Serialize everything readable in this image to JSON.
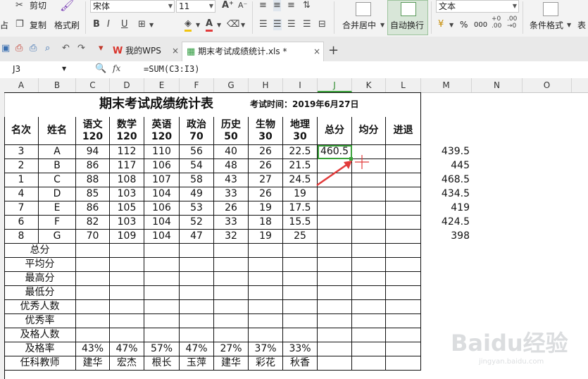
{
  "ribbon": {
    "clipboard": {
      "cut": "剪切",
      "copy": "复制",
      "format_painter": "格式刷",
      "paste_fragment": "占"
    },
    "font": {
      "name": "宋体",
      "size": "11"
    },
    "alignment": {
      "merge_center": "合并居中",
      "wrap_text": "自动换行"
    },
    "number": {
      "format": "文本",
      "percent": "%",
      "thousands": "000"
    },
    "styles": {
      "conditional_format": "条件格式",
      "table_fragment": "表"
    }
  },
  "tabbar": {
    "tabs": [
      {
        "label": "我的WPS",
        "close": "×"
      },
      {
        "label": "期末考试成绩统计.xls *",
        "close": "×"
      }
    ],
    "new_tab": "+"
  },
  "formula_bar": {
    "cell_ref": "J3",
    "fx": "fx",
    "formula": "=SUM(C3:I3)"
  },
  "columns": [
    "A",
    "B",
    "C",
    "D",
    "E",
    "F",
    "G",
    "H",
    "I",
    "J",
    "K",
    "L",
    "M",
    "N",
    "O"
  ],
  "selected_column": "J",
  "sheet": {
    "title": "期末考试成绩统计表",
    "exam_time": "考试时间：2019年6月27日",
    "headers": [
      {
        "l1": "名次"
      },
      {
        "l1": "姓名"
      },
      {
        "l1": "语文",
        "l2": "120"
      },
      {
        "l1": "数学",
        "l2": "120"
      },
      {
        "l1": "英语",
        "l2": "120"
      },
      {
        "l1": "政治",
        "l2": "70"
      },
      {
        "l1": "历史",
        "l2": "50"
      },
      {
        "l1": "生物",
        "l2": "30"
      },
      {
        "l1": "地理",
        "l2": "30"
      },
      {
        "l1": "总分"
      },
      {
        "l1": "均分"
      },
      {
        "l1": "进退"
      }
    ],
    "rows": [
      [
        "3",
        "A",
        "94",
        "112",
        "110",
        "56",
        "40",
        "26",
        "22.5",
        "460.5",
        "",
        "",
        "439.5"
      ],
      [
        "2",
        "B",
        "86",
        "117",
        "106",
        "54",
        "48",
        "26",
        "21.5",
        "",
        "",
        "",
        "445"
      ],
      [
        "1",
        "C",
        "88",
        "108",
        "107",
        "58",
        "43",
        "27",
        "24.5",
        "",
        "",
        "",
        "468.5"
      ],
      [
        "4",
        "D",
        "85",
        "103",
        "104",
        "49",
        "33",
        "26",
        "19",
        "",
        "",
        "",
        "434.5"
      ],
      [
        "7",
        "E",
        "86",
        "105",
        "106",
        "53",
        "26",
        "19",
        "17.5",
        "",
        "",
        "",
        "419"
      ],
      [
        "6",
        "F",
        "82",
        "103",
        "104",
        "52",
        "33",
        "18",
        "15.5",
        "",
        "",
        "",
        "424.5"
      ],
      [
        "8",
        "G",
        "70",
        "109",
        "104",
        "47",
        "32",
        "19",
        "25",
        "",
        "",
        "",
        "398"
      ]
    ],
    "summary_rows": [
      {
        "label": "总分",
        "values": []
      },
      {
        "label": "平均分",
        "values": []
      },
      {
        "label": "最高分",
        "values": []
      },
      {
        "label": "最低分",
        "values": []
      },
      {
        "label": "优秀人数",
        "values": []
      },
      {
        "label": "优秀率",
        "values": []
      },
      {
        "label": "及格人数",
        "values": []
      },
      {
        "label": "及格率",
        "values": [
          "43%",
          "47%",
          "57%",
          "47%",
          "27%",
          "37%",
          "33%"
        ]
      },
      {
        "label": "任科教师",
        "values": [
          "建华",
          "宏杰",
          "根长",
          "玉萍",
          "建华",
          "彩花",
          "秋香"
        ]
      }
    ]
  },
  "watermark": {
    "brand": "Baidu经验",
    "url": "jingyan.baidu.com"
  },
  "colors": {
    "accent_green": "#3aa03a",
    "arrow_red": "#e23b3b",
    "wps_red": "#d9342b"
  }
}
